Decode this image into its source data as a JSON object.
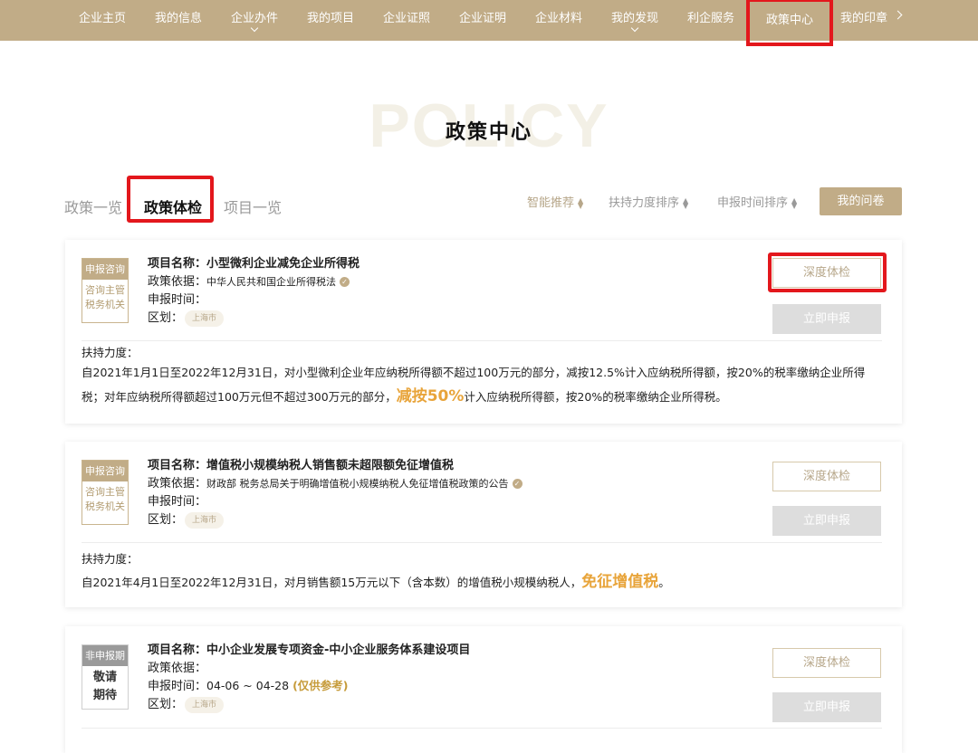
{
  "nav": {
    "items": [
      {
        "label": "企业主页"
      },
      {
        "label": "我的信息"
      },
      {
        "label": "企业办件"
      },
      {
        "label": "我的项目"
      },
      {
        "label": "企业证照"
      },
      {
        "label": "企业证明"
      },
      {
        "label": "企业材料"
      },
      {
        "label": "我的发现"
      },
      {
        "label": "利企服务"
      },
      {
        "label": "政策中心"
      },
      {
        "label": "我的印章"
      }
    ],
    "active": "政策中心"
  },
  "page": {
    "watermark": "POLICY",
    "title": "政策中心"
  },
  "tabs": [
    {
      "label": "政策一览"
    },
    {
      "label": "政策体检"
    },
    {
      "label": "项目一览"
    }
  ],
  "sort": {
    "smart": "智能推荐",
    "support": "扶持力度排序",
    "time": "申报时间排序",
    "survey_button": "我的问卷"
  },
  "cards": [
    {
      "badge_top": "申报咨询",
      "badge_lines": [
        "咨询主管",
        "税务机关"
      ],
      "name_key": "项目名称：",
      "name": "小型微利企业减免企业所得税",
      "basis_key": "政策依据：",
      "basis": "中华人民共和国企业所得税法",
      "time_key": "申报时间：",
      "time": "",
      "region_key": "区划：",
      "region": "上海市",
      "check_button": "深度体检",
      "apply_button": "立即申报",
      "support_key": "扶持力度：",
      "support_pre": "自2021年1月1日至2022年12月31日，对小型微利企业年应纳税所得额不超过100万元的部分，减按12.5%计入应纳税所得额，按20%的税率缴纳企业所得税；对年应纳税所得额超过100万元但不超过300万元的部分，",
      "support_hl": "减按50%",
      "support_post": "计入应纳税所得额，按20%的税率缴纳企业所得税。"
    },
    {
      "badge_top": "申报咨询",
      "badge_lines": [
        "咨询主管",
        "税务机关"
      ],
      "name_key": "项目名称：",
      "name": "增值税小规模纳税人销售额未超限额免征增值税",
      "basis_key": "政策依据：",
      "basis": "财政部 税务总局关于明确增值税小规模纳税人免征增值税政策的公告",
      "time_key": "申报时间：",
      "time": "",
      "region_key": "区划：",
      "region": "上海市",
      "check_button": "深度体检",
      "apply_button": "立即申报",
      "support_key": "扶持力度：",
      "support_pre": "自2021年4月1日至2022年12月31日，对月销售额15万元以下（含本数）的增值税小规模纳税人，",
      "support_hl": "免征增值税",
      "support_post": "。"
    },
    {
      "badge_top": "非申报期",
      "badge_lines": [
        "敬请",
        "期待"
      ],
      "name_key": "项目名称：",
      "name": "中小企业发展专项资金-中小企业服务体系建设项目",
      "basis_key": "政策依据：",
      "basis": "",
      "time_key": "申报时间：",
      "time": "04-06 ~ 04-28",
      "time_note": "(仅供参考)",
      "region_key": "区划：",
      "region": "上海市",
      "check_button": "深度体检",
      "apply_button": "立即申报"
    }
  ]
}
